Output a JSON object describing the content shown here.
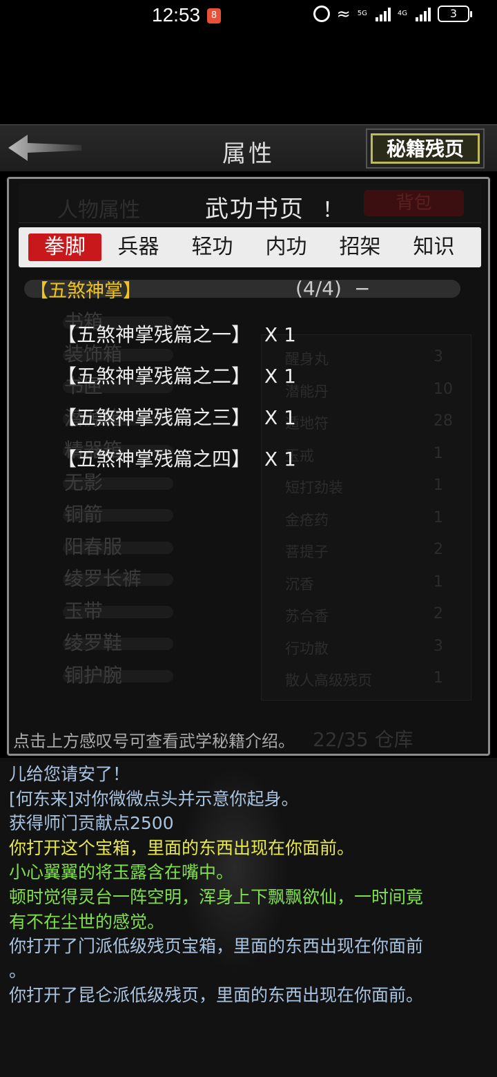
{
  "status": {
    "time": "12:53",
    "notif_badge": "8",
    "net1": "5G",
    "net2": "4G",
    "battery": "3"
  },
  "topbar": {
    "title": "属性",
    "secret_button": "秘籍残页"
  },
  "background": {
    "tab_attr": "人物属性",
    "tab_bag": "背包",
    "rows": [
      "书箱",
      "装饰箱",
      "书匣",
      "潜源箱",
      "精器箱",
      "无影",
      "铜箭",
      "阳春服",
      "绫罗长裤",
      "玉带",
      "绫罗鞋",
      "铜护腕"
    ],
    "right_items": [
      {
        "name": "醒身丸",
        "n": "3"
      },
      {
        "name": "潜能丹",
        "n": "10"
      },
      {
        "name": "遁地符",
        "n": "28"
      },
      {
        "name": "玉戒",
        "n": "1"
      },
      {
        "name": "短打劲装",
        "n": "1"
      },
      {
        "name": "金疮药",
        "n": "1"
      },
      {
        "name": "菩提子",
        "n": "2"
      },
      {
        "name": "沉香",
        "n": "1"
      },
      {
        "name": "苏合香",
        "n": "2"
      },
      {
        "name": "行功散",
        "n": "3"
      },
      {
        "name": "散人高级残页",
        "n": "1"
      }
    ],
    "store": "22/35 仓库"
  },
  "dialog": {
    "title": "武功书页",
    "info": "！",
    "tabs": [
      "拳脚",
      "兵器",
      "轻功",
      "内功",
      "招架",
      "知识"
    ],
    "active_tab": 0,
    "section": {
      "name": "【五煞神掌】",
      "count": "(4/4)",
      "toggle": "−"
    },
    "pages": [
      {
        "name": "【五煞神掌残篇之一】",
        "qty": "X 1"
      },
      {
        "name": "【五煞神掌残篇之二】",
        "qty": "X 1"
      },
      {
        "name": "【五煞神掌残篇之三】",
        "qty": "X 1"
      },
      {
        "name": "【五煞神掌残篇之四】",
        "qty": "X 1"
      }
    ],
    "hint": "点击上方感叹号可查看武学秘籍介绍。"
  },
  "log": [
    {
      "text": "儿给您请安了！",
      "color": "#a9c4e0"
    },
    {
      "text": "[何东来]对你微微点头并示意你起身。",
      "color": "#a9c4e0"
    },
    {
      "text": "获得师门贡献点2500",
      "color": "#a9c4e0"
    },
    {
      "text": "你打开这个宝箱，里面的东西出现在你面前。",
      "color": "#e8e84a"
    },
    {
      "text": "小心翼翼的将玉露含在嘴中。",
      "color": "#7fe04a"
    },
    {
      "text": "顿时觉得灵台一阵空明，浑身上下飘飘欲仙，一时间竟",
      "color": "#7fe04a"
    },
    {
      "text": "有不在尘世的感觉。",
      "color": "#7fe04a"
    },
    {
      "text": "你打开了门派低级残页宝箱，里面的东西出现在你面前",
      "color": "#a9c4e0"
    },
    {
      "text": "。",
      "color": "#a9c4e0"
    },
    {
      "text": "你打开了昆仑派低级残页，里面的东西出现在你面前。",
      "color": "#a9c4e0"
    }
  ]
}
